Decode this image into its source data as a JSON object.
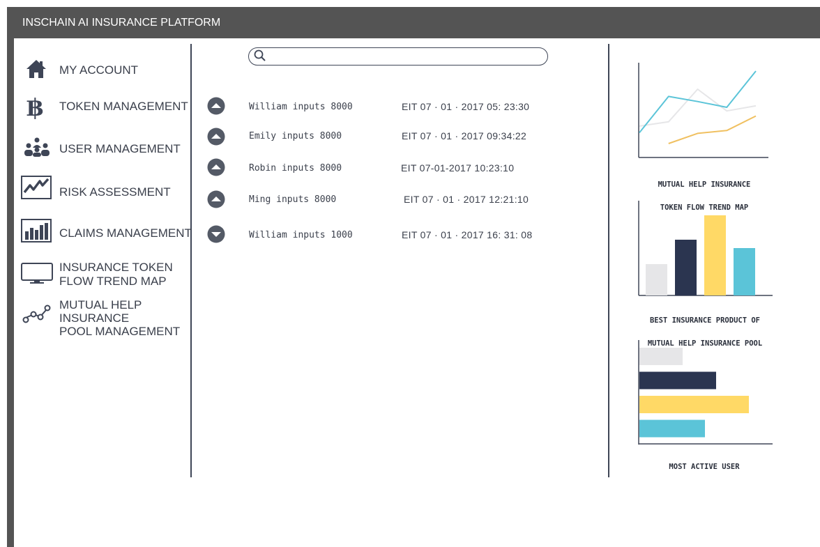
{
  "app": {
    "title": "INSCHAIN AI INSURANCE PLATFORM"
  },
  "sidebar": {
    "items": [
      {
        "label": "MY ACCOUNT",
        "icon": "home-icon"
      },
      {
        "label": "TOKEN MANAGEMENT",
        "icon": "baht-icon"
      },
      {
        "label": "USER MANAGEMENT",
        "icon": "users-icon"
      },
      {
        "label": "RISK ASSESSMENT",
        "icon": "trend-chart-icon"
      },
      {
        "label": "CLAIMS MANAGEMENT",
        "icon": "bar-chart-icon"
      },
      {
        "label_line1": "INSURANCE TOKEN",
        "label_line2": "FLOW TREND MAP",
        "icon": "monitor-icon"
      },
      {
        "label_line1": "MUTUAL HELP",
        "label_line2": "INSURANCE",
        "label_line3": "POOL MANAGEMENT",
        "icon": "network-icon"
      }
    ]
  },
  "search": {
    "placeholder": "",
    "value": ""
  },
  "transactions": [
    {
      "text": "William inputs 8000",
      "time": "EIT  07 · 01 · 2017 05: 23:30",
      "direction": "up"
    },
    {
      "text": "Emily inputs 8000",
      "time": "EIT 07 · 01 · 2017 09:34:22",
      "direction": "up"
    },
    {
      "text": "Robin inputs 8000",
      "time": "EIT 07-01-2017 10:23:10",
      "direction": "up"
    },
    {
      "text": "Ming inputs 8000",
      "time": "EIT 07 · 01 · 2017 12:21:10",
      "direction": "up"
    },
    {
      "text": "William inputs 1000",
      "time": "EIT 07 · 01 · 2017 16: 31: 08",
      "direction": "down"
    }
  ],
  "colors": {
    "frame": "#545454",
    "navy": "#2b3550",
    "yellow": "#ffd966",
    "cyan": "#5bc4d8",
    "light_gray": "#e6e6e8",
    "orange_line": "#f0c060"
  },
  "chart_data": [
    {
      "type": "line",
      "caption_line1": "MUTUAL HELP INSURANCE",
      "caption_line2": "TOKEN FLOW TREND MAP",
      "x": [
        0,
        1,
        2,
        3,
        4
      ],
      "series": [
        {
          "color": "#5bc4d8",
          "values": [
            1.5,
            6.5,
            5.8,
            5.0,
            10
          ]
        },
        {
          "color": "#e6e6e8",
          "values": [
            2.4,
            3.0,
            7.5,
            4.5,
            5.2
          ]
        },
        {
          "color": "#f0c060",
          "values": [
            null,
            0,
            1.4,
            1.8,
            3.8
          ]
        }
      ]
    },
    {
      "type": "bar",
      "caption_line1": "BEST INSURANCE PRODUCT OF",
      "caption_line2": "MUTUAL HELP INSURANCE POOL",
      "values": [
        45,
        80,
        115,
        68
      ],
      "colors": [
        "#e6e6e8",
        "#2b3550",
        "#ffd966",
        "#5bc4d8"
      ]
    },
    {
      "type": "bar-horizontal",
      "caption": "MOST ACTIVE USER",
      "values": [
        62,
        110,
        157,
        94
      ],
      "colors": [
        "#e6e6e8",
        "#2b3550",
        "#ffd966",
        "#5bc4d8"
      ]
    }
  ]
}
